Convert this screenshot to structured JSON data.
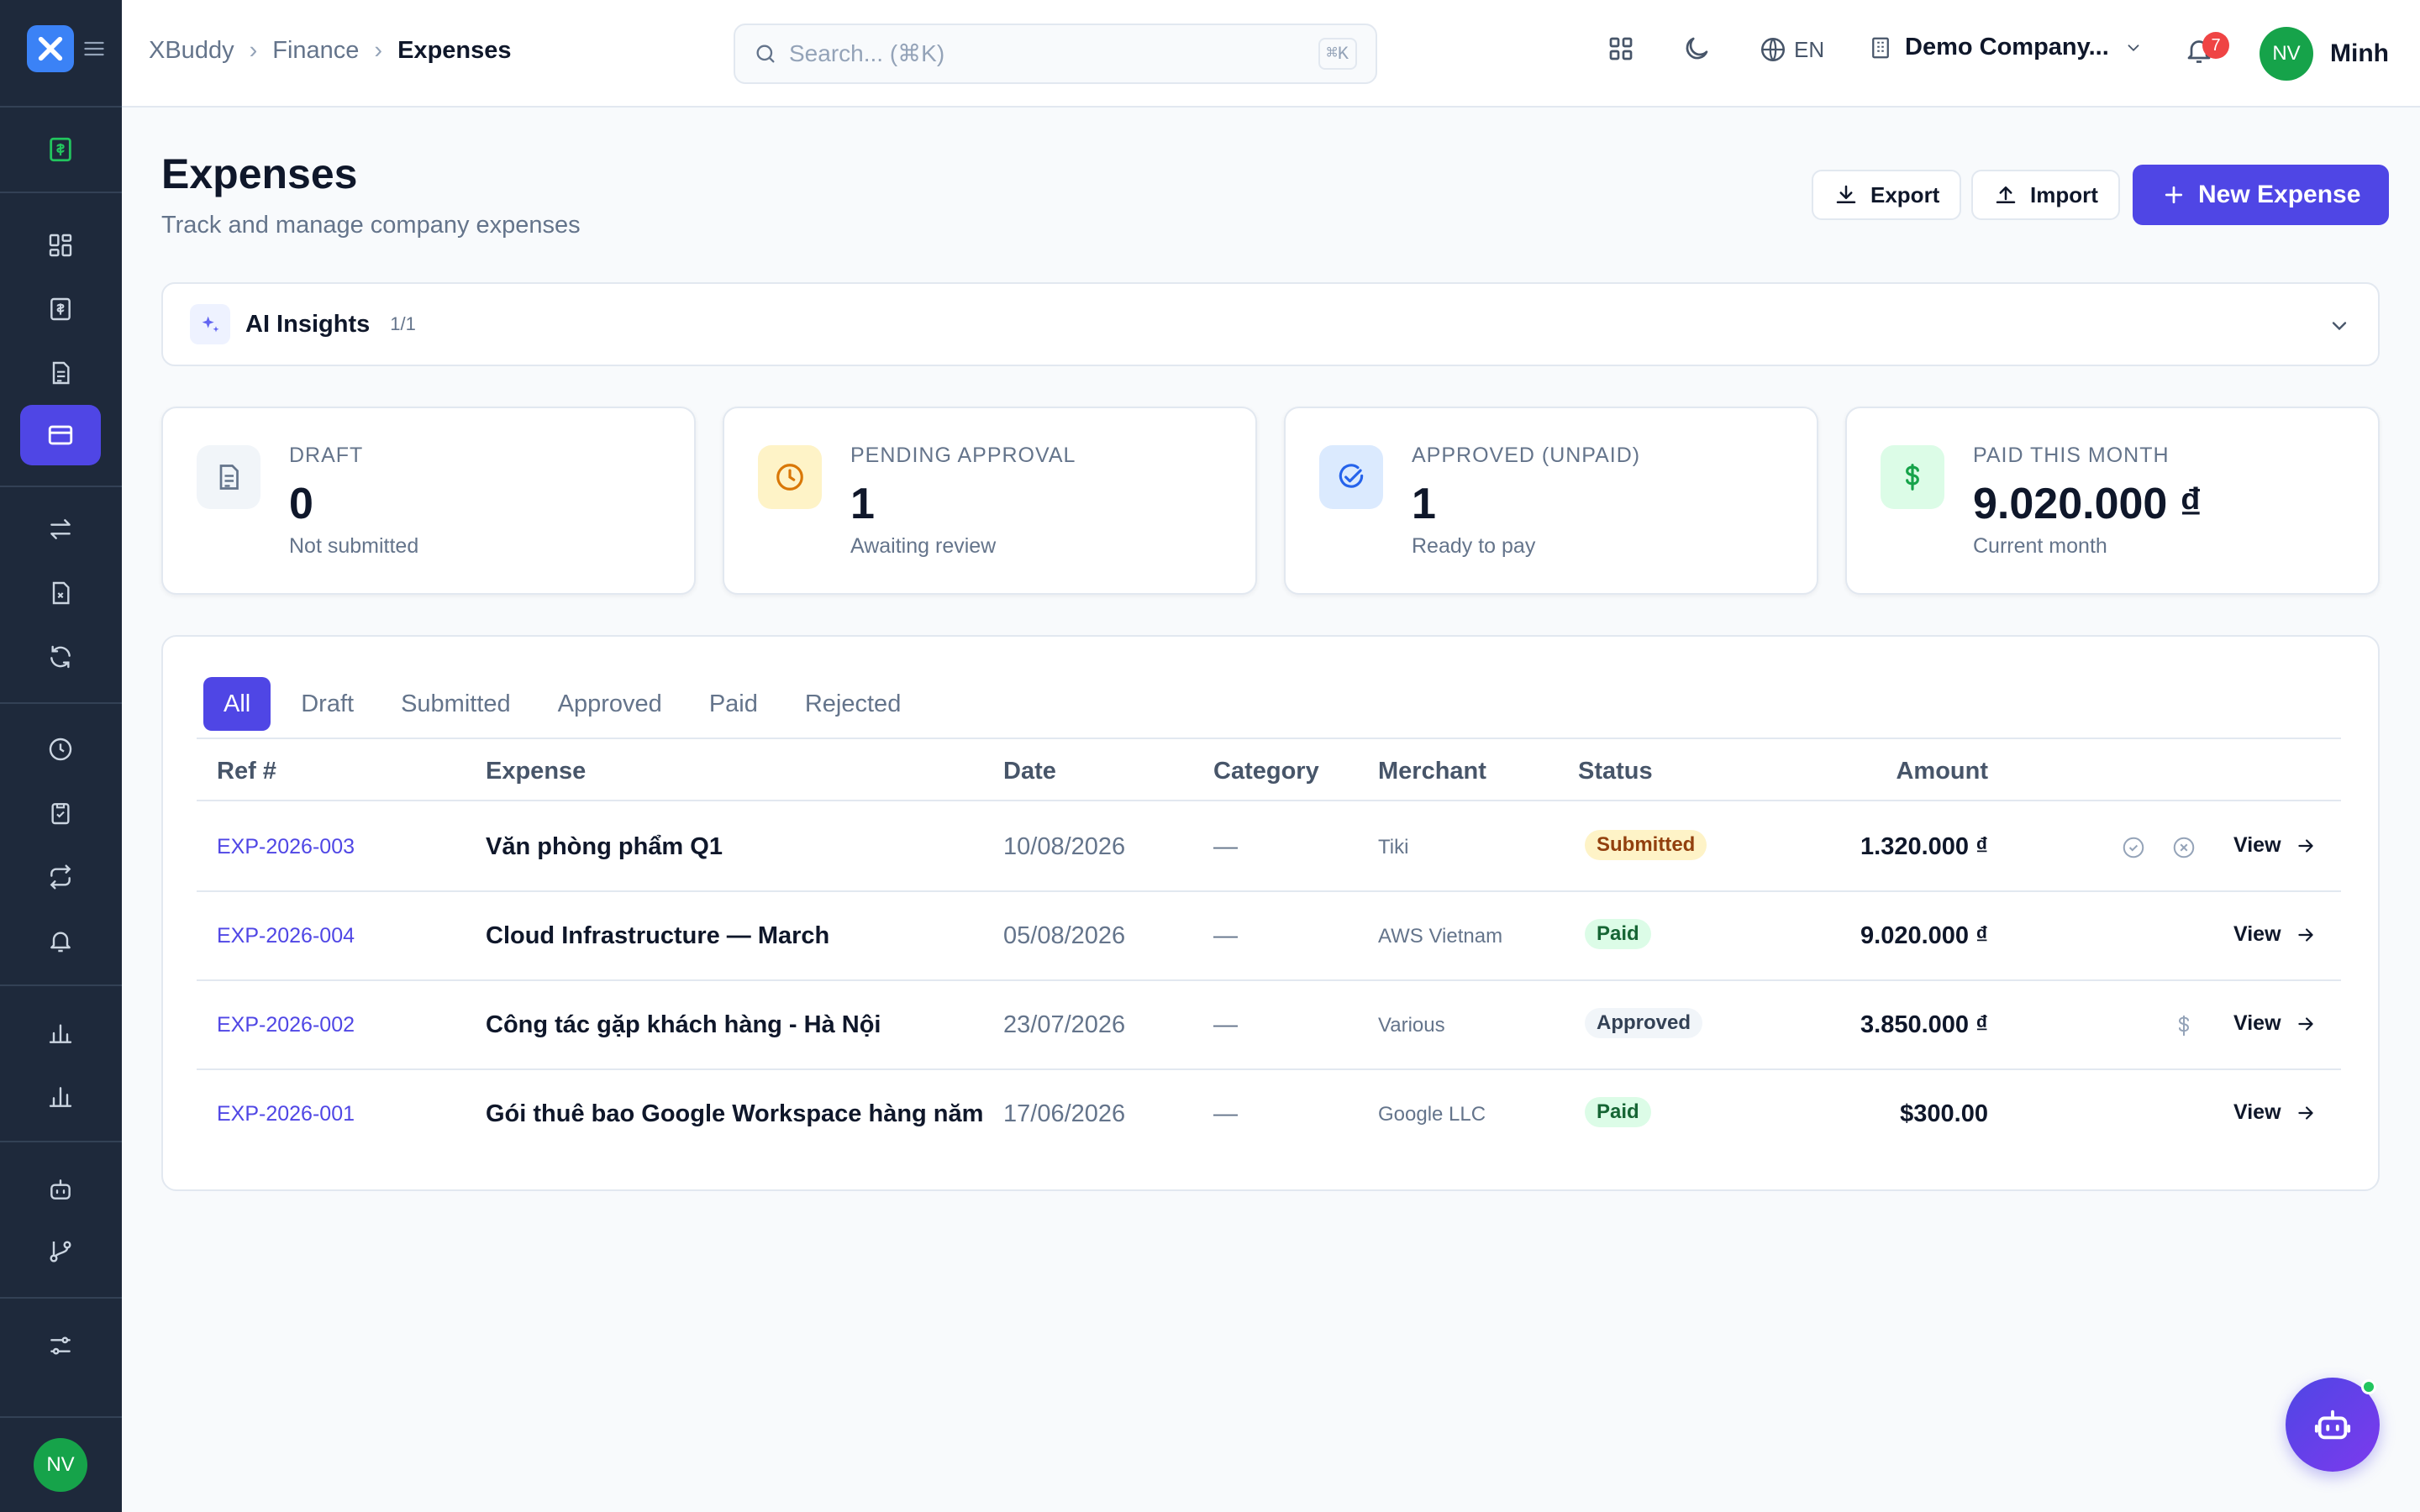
{
  "app": {
    "logo_icon": "x-logo-icon"
  },
  "sidebar": {
    "items": [
      {
        "icon": "dashboard-icon"
      },
      {
        "icon": "receipt-icon"
      },
      {
        "icon": "document-icon"
      },
      {
        "icon": "credit-card-icon",
        "active": true
      },
      {
        "icon": "transfer-icon"
      },
      {
        "icon": "file-x-icon"
      },
      {
        "icon": "refresh-icon"
      },
      {
        "icon": "clock-icon"
      },
      {
        "icon": "clipboard-check-icon"
      },
      {
        "icon": "repeat-icon"
      },
      {
        "icon": "bell-icon"
      },
      {
        "icon": "bar-chart-icon"
      },
      {
        "icon": "bar-chart-2-icon"
      },
      {
        "icon": "bot-icon"
      },
      {
        "icon": "git-branch-icon"
      },
      {
        "icon": "sliders-icon"
      }
    ],
    "avatar": "NV"
  },
  "topbar": {
    "breadcrumb": [
      "XBuddy",
      "Finance",
      "Expenses"
    ],
    "search_placeholder": "Search... (⌘K)",
    "search_shortcut": "⌘K",
    "language": "EN",
    "company": "Demo Company...",
    "notifications": "7",
    "user_initials": "NV",
    "user_name": "Minh"
  },
  "header": {
    "title": "Expenses",
    "subtitle": "Track and manage company expenses",
    "export_label": "Export",
    "import_label": "Import",
    "new_label": "New Expense"
  },
  "insights": {
    "title": "AI Insights",
    "count": "1/1"
  },
  "kpis": [
    {
      "label": "DRAFT",
      "value": "0",
      "sub": "Not submitted",
      "icon": "file-text-icon",
      "color": "#64748b",
      "bg": "#f1f5f9"
    },
    {
      "label": "PENDING APPROVAL",
      "value": "1",
      "sub": "Awaiting review",
      "icon": "clock-icon",
      "color": "#d97706",
      "bg": "#fef3c7"
    },
    {
      "label": "APPROVED (UNPAID)",
      "value": "1",
      "sub": "Ready to pay",
      "icon": "check-circle-icon",
      "color": "#2563eb",
      "bg": "#dbeafe"
    },
    {
      "label": "PAID THIS MONTH",
      "value": "9.020.000 ₫",
      "sub": "Current month",
      "icon": "dollar-icon",
      "color": "#16a34a",
      "bg": "#dcfce7"
    }
  ],
  "tabs": [
    "All",
    "Draft",
    "Submitted",
    "Approved",
    "Paid",
    "Rejected"
  ],
  "table": {
    "columns": [
      "Ref #",
      "Expense",
      "Date",
      "Category",
      "Merchant",
      "Status",
      "Amount"
    ],
    "rows": [
      {
        "ref": "EXP-2026-003",
        "expense": "Văn phòng phẩm Q1",
        "date": "10/08/2026",
        "category": "—",
        "merchant": "Tiki",
        "status": "Submitted",
        "amount": "1.320.000 ₫",
        "view": "View"
      },
      {
        "ref": "EXP-2026-004",
        "expense": "Cloud Infrastructure — March",
        "date": "05/08/2026",
        "category": "—",
        "merchant": "AWS Vietnam",
        "status": "Paid",
        "amount": "9.020.000 ₫",
        "view": "View"
      },
      {
        "ref": "EXP-2026-002",
        "expense": "Công tác gặp khách hàng - Hà Nội",
        "date": "23/07/2026",
        "category": "—",
        "merchant": "Various",
        "status": "Approved",
        "amount": "3.850.000 ₫",
        "view": "View"
      },
      {
        "ref": "EXP-2026-001",
        "expense": "Gói thuê bao Google Workspace hàng năm",
        "date": "17/06/2026",
        "category": "—",
        "merchant": "Google LLC",
        "status": "Paid",
        "amount": "$300.00",
        "view": "View"
      }
    ]
  },
  "status_colors": {
    "Submitted": {
      "bg": "#fef3c7",
      "fg": "#92400e"
    },
    "Paid": {
      "bg": "#dcfce7",
      "fg": "#166534"
    },
    "Approved": {
      "bg": "#f1f5f9",
      "fg": "#334155"
    }
  }
}
